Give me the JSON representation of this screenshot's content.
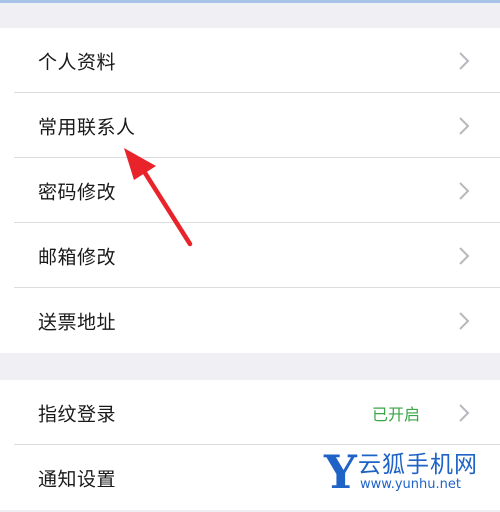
{
  "account_group": {
    "items": [
      {
        "label": "个人资料"
      },
      {
        "label": "常用联系人"
      },
      {
        "label": "密码修改"
      },
      {
        "label": "邮箱修改"
      },
      {
        "label": "送票地址"
      }
    ]
  },
  "security_group": {
    "fingerprint": {
      "label": "指纹登录",
      "status": "已开启"
    },
    "notification": {
      "label": "通知设置"
    }
  },
  "watermark": {
    "logo_letter": "Y",
    "name": "云狐手机网",
    "url": "www.yunhu.net"
  },
  "colors": {
    "background": "#efeff4",
    "status_on": "#3aa646",
    "annotation_arrow": "#e8232a",
    "watermark": "#1f63c6"
  },
  "icons": {
    "row_chevron": "chevron-right-icon",
    "annotation": "red-arrow-pointer"
  }
}
